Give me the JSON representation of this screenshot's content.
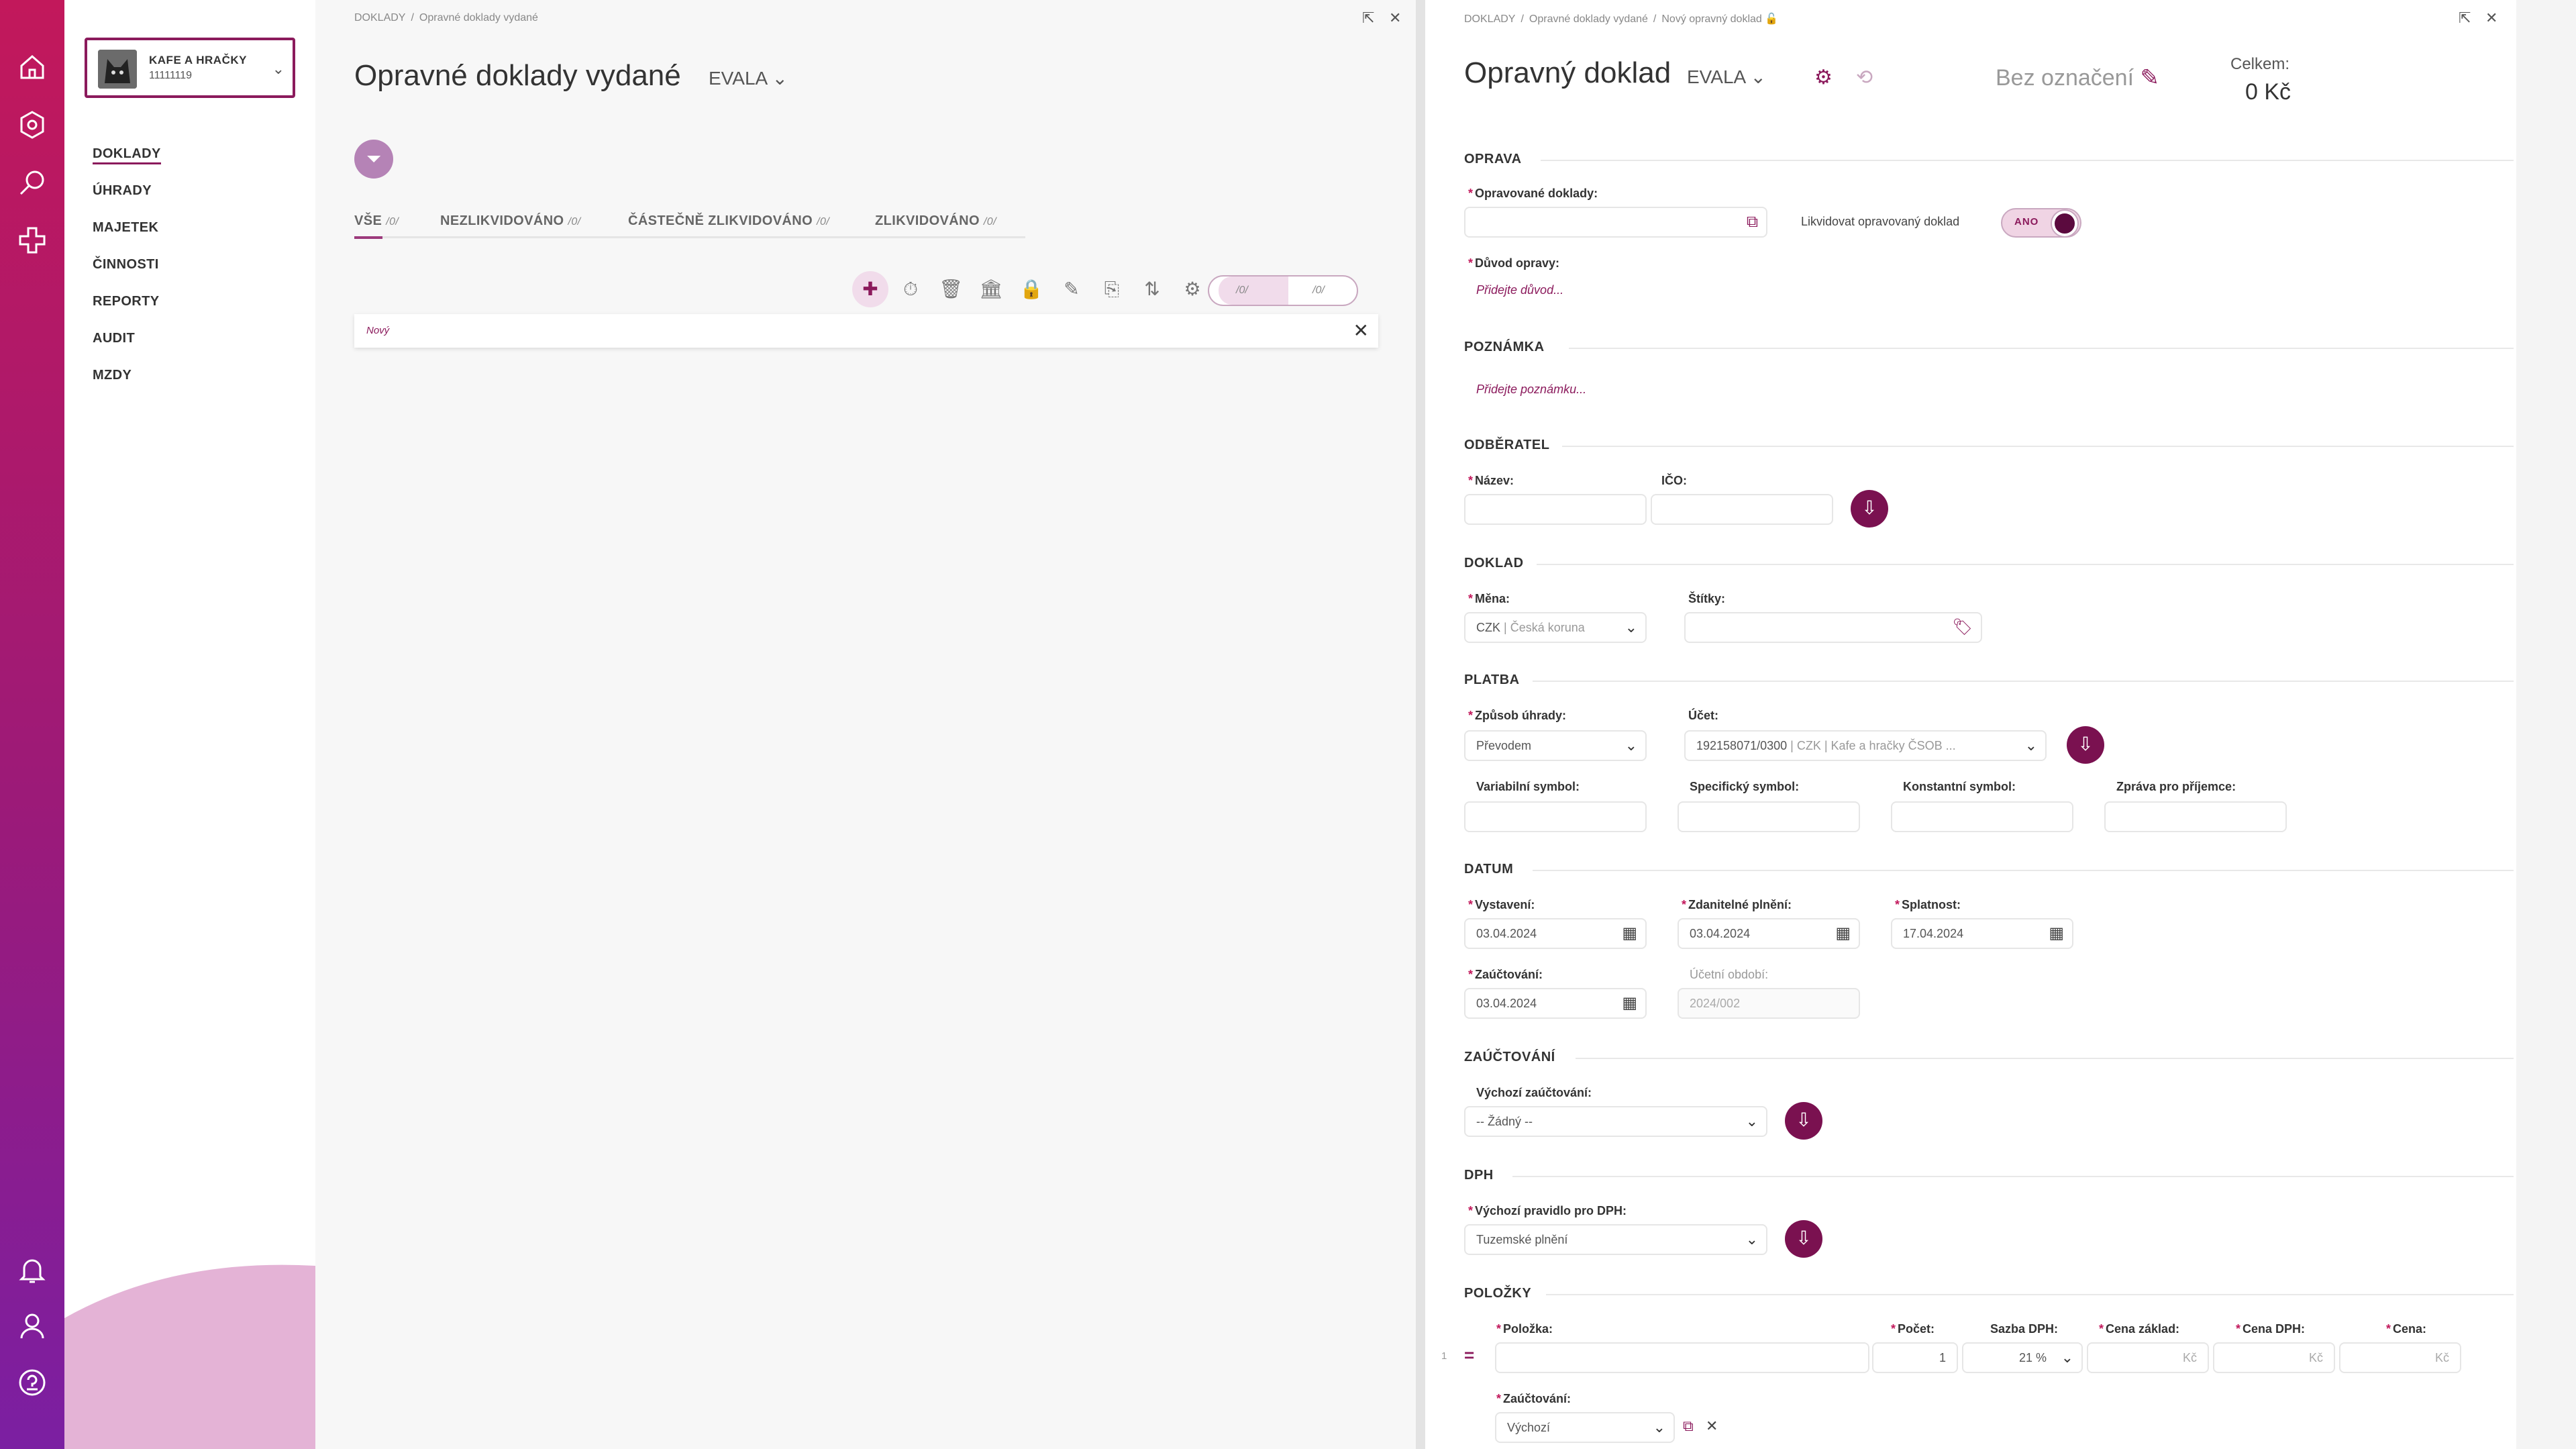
{
  "sidebar": {
    "company_name": "KAFE A HRAČKY",
    "company_id": "11111119",
    "items": [
      "DOKLADY",
      "ÚHRADY",
      "MAJETEK",
      "ČINNOSTI",
      "REPORTY",
      "AUDIT",
      "MZDY"
    ]
  },
  "list_panel": {
    "breadcrumb": [
      "DOKLADY",
      "Opravné doklady vydané"
    ],
    "title": "Opravné doklady vydané",
    "evala": "EVALA",
    "tabs": [
      {
        "label": "VŠE",
        "count": "/0/"
      },
      {
        "label": "NEZLIKVIDOVÁNO",
        "count": "/0/"
      },
      {
        "label": "ČÁSTEČNĚ ZLIKVIDOVÁNO",
        "count": "/0/"
      },
      {
        "label": "ZLIKVIDOVÁNO",
        "count": "/0/"
      }
    ],
    "seg_a": "/0/",
    "seg_b": "/0/",
    "new_row": "Nový"
  },
  "detail": {
    "breadcrumb": [
      "DOKLADY",
      "Opravné doklady vydané",
      "Nový opravný doklad"
    ],
    "title": "Opravný doklad",
    "evala": "EVALA",
    "label_title": "Bez označení",
    "total_label": "Celkem:",
    "total_value": "0 Kč",
    "sections": {
      "oprava": "OPRAVA",
      "poznamka": "POZNÁMKA",
      "odberatel": "ODBĚRATEL",
      "doklad": "DOKLAD",
      "platba": "PLATBA",
      "datum": "DATUM",
      "zauctovani": "ZAÚČTOVÁNÍ",
      "dph": "DPH",
      "polozky": "POLOŽKY"
    },
    "labels": {
      "opravovane": "Opravované doklady:",
      "likvidovat": "Likvidovat opravovaný doklad",
      "toggle": "ANO",
      "duvod": "Důvod opravy:",
      "duvod_hint": "Přidejte důvod...",
      "poznamka_hint": "Přidejte poznámku...",
      "nazev": "Název:",
      "ico": "IČO:",
      "mena": "Měna:",
      "stitky": "Štítky:",
      "zpusob": "Způsob úhrady:",
      "ucet": "Účet:",
      "vs": "Variabilní symbol:",
      "ss": "Specifický symbol:",
      "ks": "Konstantní symbol:",
      "zprava": "Zpráva pro příjemce:",
      "vystaveni": "Vystavení:",
      "zdanitelne": "Zdanitelné plnění:",
      "splatnost": "Splatnost:",
      "zauctovani": "Zaúčtování:",
      "ucetni_obdobi": "Účetní období:",
      "vychozi_zauct": "Výchozí zaúčtování:",
      "vychozi_dph": "Výchozí pravidlo pro DPH:",
      "polozka": "Položka:",
      "pocet": "Počet:",
      "sazba": "Sazba DPH:",
      "cena_zaklad": "Cena základ:",
      "cena_dph": "Cena DPH:",
      "cena": "Cena:",
      "item_zauct": "Zaúčtování:"
    },
    "values": {
      "mena_code": "CZK",
      "mena_name": "| Česká koruna",
      "zpusob": "Převodem",
      "ucet_num": "192158071/0300",
      "ucet_rest": "| CZK | Kafe a hračky ČSOB ...",
      "vystaveni": "03.04.2024",
      "zdanitelne": "03.04.2024",
      "splatnost": "17.04.2024",
      "zauctovani": "03.04.2024",
      "ucetni_obdobi": "2024/002",
      "vychozi_zauct": "-- Žádný --",
      "vychozi_dph": "Tuzemské plnění",
      "row_no": "1",
      "pocet": "1",
      "sazba": "21 %",
      "kc": "Kč",
      "item_zauct": "Výchozí"
    }
  }
}
